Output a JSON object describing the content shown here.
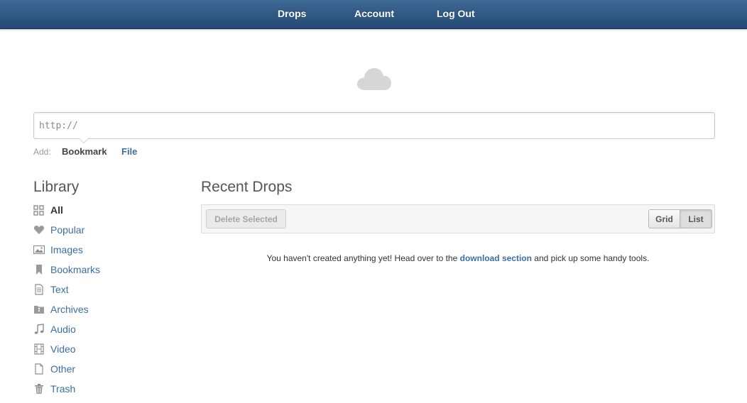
{
  "nav": {
    "drops": "Drops",
    "account": "Account",
    "logout": "Log Out"
  },
  "add_bar": {
    "url_placeholder": "http://",
    "url_value": "",
    "add_label": "Add:",
    "bookmark": "Bookmark",
    "file": "File"
  },
  "library": {
    "title": "Library",
    "items": [
      {
        "label": "All",
        "icon": "grid-icon",
        "active": true
      },
      {
        "label": "Popular",
        "icon": "heart-icon"
      },
      {
        "label": "Images",
        "icon": "image-icon"
      },
      {
        "label": "Bookmarks",
        "icon": "bookmark-icon"
      },
      {
        "label": "Text",
        "icon": "text-document-icon"
      },
      {
        "label": "Archives",
        "icon": "archive-icon"
      },
      {
        "label": "Audio",
        "icon": "music-note-icon"
      },
      {
        "label": "Video",
        "icon": "film-icon"
      },
      {
        "label": "Other",
        "icon": "blank-document-icon"
      },
      {
        "label": "Trash",
        "icon": "trash-icon"
      }
    ]
  },
  "drops": {
    "title": "Recent Drops",
    "delete_selected": "Delete Selected",
    "grid": "Grid",
    "list": "List",
    "view_selected": "List",
    "empty_before": "You haven't created anything yet! Head over to the ",
    "empty_link": "download section",
    "empty_after": " and pick up some handy tools."
  },
  "colors": {
    "nav_bar": "#2f5883",
    "link": "#3a6ea5",
    "icon_gray": "#8e8e8e"
  }
}
